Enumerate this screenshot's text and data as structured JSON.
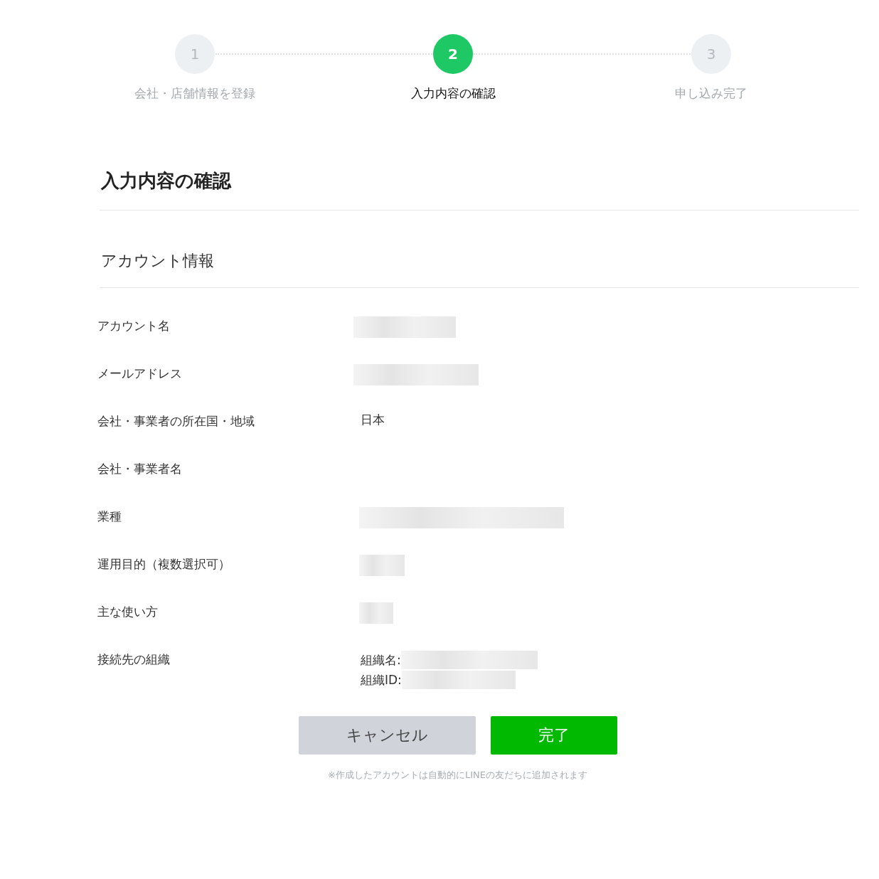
{
  "steps": [
    {
      "number": "1",
      "label": "会社・店舗情報を登録",
      "selected": false
    },
    {
      "number": "2",
      "label": "入力内容の確認",
      "selected": true
    },
    {
      "number": "3",
      "label": "申し込み完了",
      "selected": false
    }
  ],
  "page_title": "入力内容の確認",
  "section_title": "アカウント情報",
  "rows": [
    {
      "label": "アカウント名",
      "kind": "redacted"
    },
    {
      "label": "メールアドレス",
      "kind": "redacted"
    },
    {
      "label": "会社・事業者の所在国・地域",
      "kind": "text",
      "value": "日本"
    },
    {
      "label": "会社・事業者名",
      "kind": "empty"
    },
    {
      "label": "業種",
      "kind": "redacted"
    },
    {
      "label": "運用目的（複数選択可）",
      "kind": "redacted"
    },
    {
      "label": "主な使い方",
      "kind": "redacted"
    },
    {
      "label": "接続先の組織",
      "kind": "fields",
      "fields": [
        {
          "label": "組織名:",
          "kind": "redacted"
        },
        {
          "label": "組織ID:",
          "kind": "redacted"
        }
      ]
    }
  ],
  "buttons": [
    {
      "label": "キャンセル",
      "kind": "secondary"
    },
    {
      "label": "完了",
      "kind": "primary"
    }
  ],
  "note": "※作成したアカウントは自動的にLINEの友だちに追加されます"
}
